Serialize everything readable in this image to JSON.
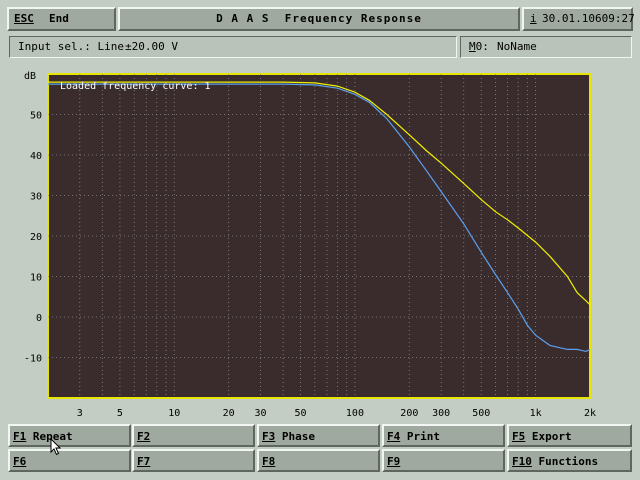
{
  "header": {
    "esc_key": "ESC",
    "esc_label": "End",
    "title": "D A A S  Frequency Response",
    "info_key": "i",
    "datetime": "30.01.10609:27"
  },
  "status": {
    "input_label": "Input sel.: Line",
    "range": "±20.00 V",
    "memory_key": "M",
    "memory_slot": "0:",
    "memory_name": "NoName"
  },
  "fkeys": [
    {
      "key": "F1",
      "label": "Repeat"
    },
    {
      "key": "F2",
      "label": ""
    },
    {
      "key": "F3",
      "label": "Phase"
    },
    {
      "key": "F4",
      "label": "Print"
    },
    {
      "key": "F5",
      "label": "Export"
    },
    {
      "key": "F6",
      "label": ""
    },
    {
      "key": "F7",
      "label": ""
    },
    {
      "key": "F8",
      "label": ""
    },
    {
      "key": "F9",
      "label": ""
    },
    {
      "key": "F10",
      "label": "Functions"
    }
  ],
  "chart_data": {
    "type": "line",
    "annotation": "Loaded frequency curve: 1",
    "ylabel": "dB",
    "xscale": "log",
    "xlim": [
      2,
      2000
    ],
    "ylim": [
      -20,
      60
    ],
    "grid": true,
    "yticks": [
      50,
      40,
      30,
      20,
      10,
      0,
      -10
    ],
    "xticks": [
      {
        "v": 3,
        "label": "3"
      },
      {
        "v": 5,
        "label": "5"
      },
      {
        "v": 10,
        "label": "10"
      },
      {
        "v": 20,
        "label": "20"
      },
      {
        "v": 30,
        "label": "30"
      },
      {
        "v": 50,
        "label": "50"
      },
      {
        "v": 100,
        "label": "100"
      },
      {
        "v": 200,
        "label": "200"
      },
      {
        "v": 300,
        "label": "300"
      },
      {
        "v": 500,
        "label": "500"
      },
      {
        "v": 1000,
        "label": "1k"
      },
      {
        "v": 2000,
        "label": "2k"
      }
    ],
    "colors": {
      "plot_bg": "#3a2c2c",
      "grid": "#8c8c8c",
      "border": "#e6e600"
    },
    "series": [
      {
        "color": "#f0f000",
        "x": [
          2,
          5,
          10,
          20,
          40,
          60,
          80,
          100,
          120,
          150,
          200,
          250,
          300,
          400,
          500,
          600,
          700,
          800,
          1000,
          1200,
          1500,
          1700,
          1900,
          2000
        ],
        "y": [
          58,
          58,
          58,
          58,
          58,
          57.8,
          57,
          55.5,
          53.5,
          50,
          45,
          41,
          38,
          33,
          29,
          26,
          24,
          22,
          18.5,
          15,
          10,
          6,
          4,
          3
        ]
      },
      {
        "color": "#5aa0f0",
        "x": [
          2,
          5,
          10,
          20,
          40,
          60,
          80,
          100,
          120,
          150,
          200,
          250,
          300,
          400,
          500,
          600,
          700,
          800,
          900,
          1000,
          1200,
          1500,
          1700,
          1900,
          2000
        ],
        "y": [
          57.5,
          57.5,
          57.5,
          57.5,
          57.5,
          57.3,
          56.5,
          55,
          53,
          49,
          42,
          36,
          31,
          23,
          16,
          10.5,
          6,
          2,
          -2,
          -4.5,
          -7,
          -8,
          -8,
          -8.5,
          -8
        ]
      }
    ]
  }
}
